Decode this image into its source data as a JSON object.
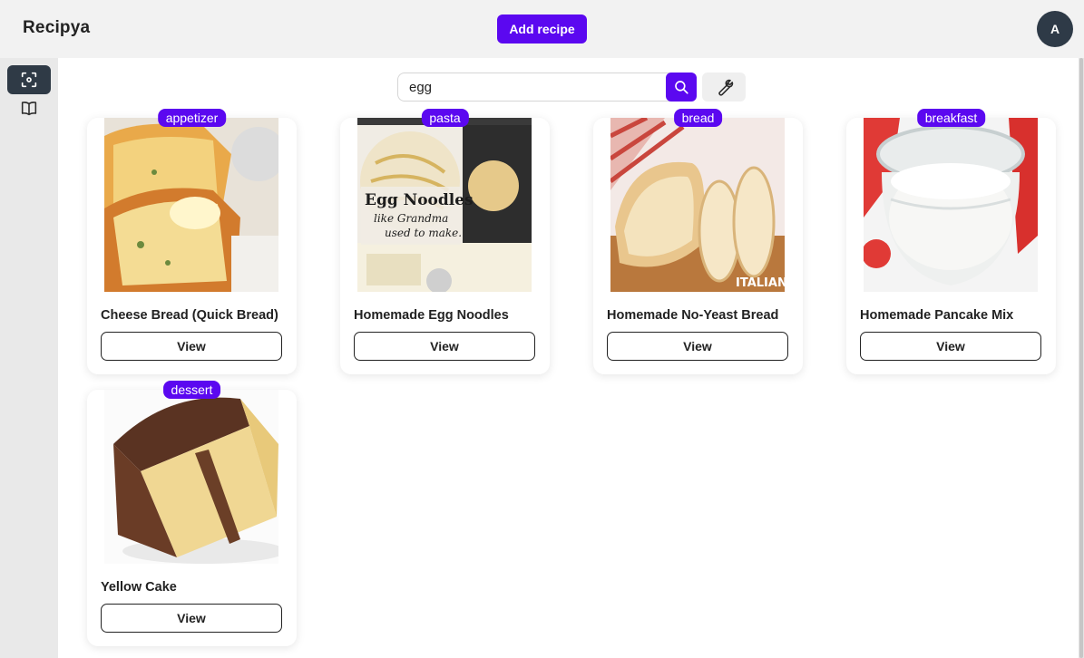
{
  "app": {
    "brand": "Recipya"
  },
  "header": {
    "add_recipe_label": "Add recipe",
    "avatar_initial": "A"
  },
  "sidebar": {
    "items": [
      {
        "icon": "scan-icon",
        "active": true
      },
      {
        "icon": "book-icon",
        "active": false
      }
    ]
  },
  "search": {
    "value": "egg",
    "placeholder": ""
  },
  "colors": {
    "accent": "#5b08f0",
    "sidebar_active": "#2f3a46",
    "avatar": "#2e3a47"
  },
  "recipes": [
    {
      "tag": "appetizer",
      "title": "Cheese Bread (Quick Bread)",
      "view_label": "View"
    },
    {
      "tag": "pasta",
      "title": "Homemade Egg Noodles",
      "view_label": "View",
      "image_text": [
        "Egg Noodles",
        "like Grandma",
        "used to make."
      ]
    },
    {
      "tag": "bread",
      "title": "Homemade No-Yeast Bread",
      "view_label": "View",
      "image_text": [
        "ITALIAN"
      ]
    },
    {
      "tag": "breakfast",
      "title": "Homemade Pancake Mix",
      "view_label": "View"
    },
    {
      "tag": "dessert",
      "title": "Yellow Cake",
      "view_label": "View"
    }
  ]
}
